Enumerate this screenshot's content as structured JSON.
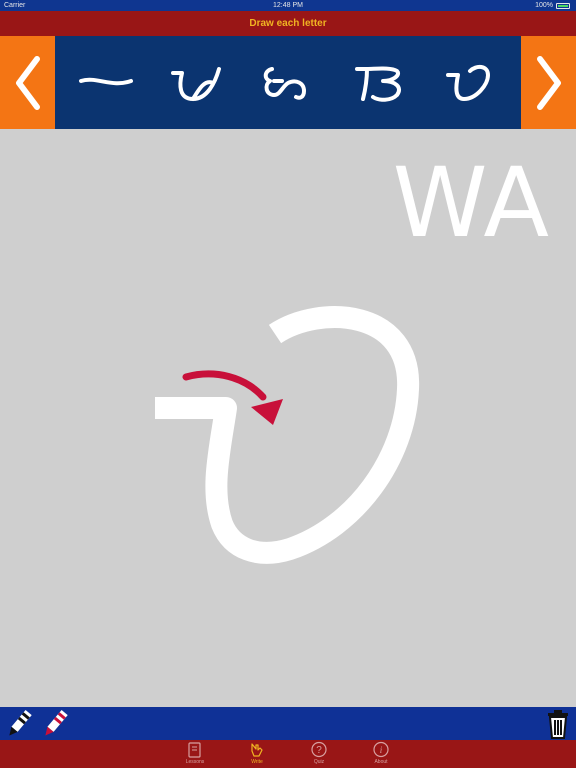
{
  "status": {
    "carrier": "Carrier",
    "time": "12:48 PM",
    "battery": "100%"
  },
  "header": {
    "title": "Draw each letter"
  },
  "letters": [
    {
      "icon": "baybayin-a-icon"
    },
    {
      "icon": "baybayin-ba-icon"
    },
    {
      "icon": "baybayin-ka-icon"
    },
    {
      "icon": "baybayin-da-icon"
    },
    {
      "icon": "baybayin-wa-icon"
    }
  ],
  "current": {
    "roman": "WA"
  },
  "tools": {
    "pen": "pen-icon",
    "eraser": "eraser-icon",
    "clear": "trash-icon"
  },
  "tabs": [
    {
      "label": "Lessons",
      "icon": "book-icon",
      "active": false
    },
    {
      "label": "Write",
      "icon": "hand-draw-icon",
      "active": true
    },
    {
      "label": "Quiz",
      "icon": "question-icon",
      "active": false
    },
    {
      "label": "About",
      "icon": "info-icon",
      "active": false
    }
  ],
  "colors": {
    "brand_red": "#991616",
    "brand_blue": "#0b3470",
    "accent_orange": "#f47514",
    "accent_gold": "#f0b422",
    "arrow": "#c8103a"
  }
}
